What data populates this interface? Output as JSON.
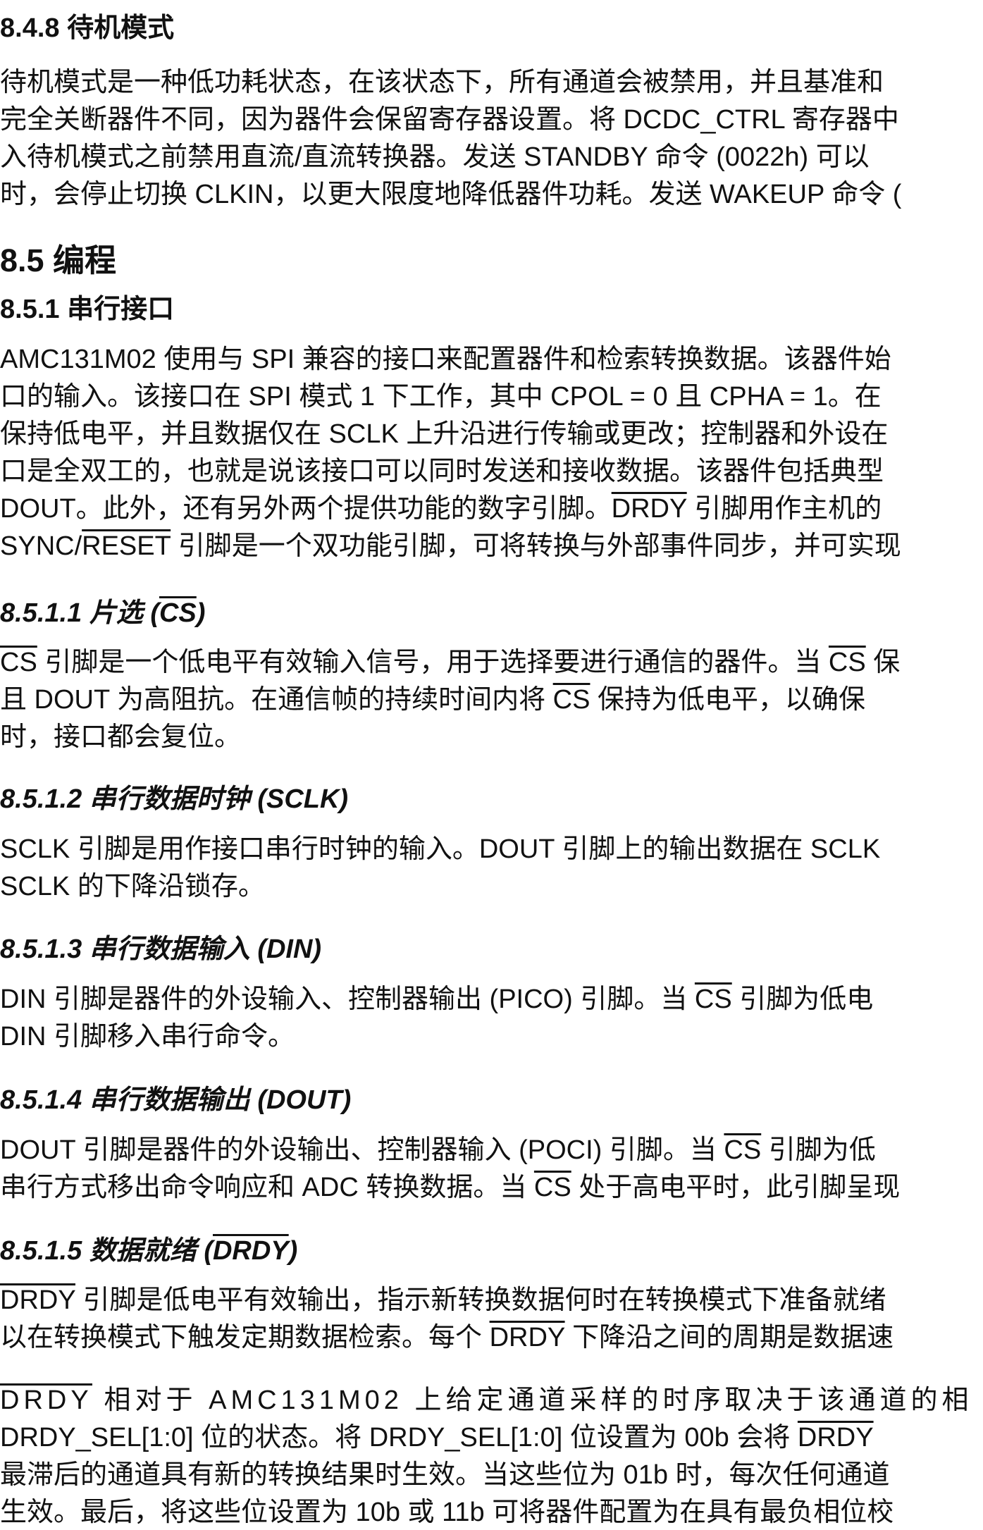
{
  "sec_848": {
    "heading": "8.4.8 待机模式",
    "lines": [
      "待机模式是一种低功耗状态，在该状态下，所有通道会被禁用，并且基准和",
      "完全关断器件不同，因为器件会保留寄存器设置。将 DCDC_CTRL 寄存器中",
      "入待机模式之前禁用直流/直流转换器。发送 STANDBY 命令 (0022h) 可以",
      "时，会停止切换 CLKIN，以更大限度地降低器件功耗。发送 WAKEUP 命令 ("
    ]
  },
  "sec_85": {
    "heading": "8.5 编程"
  },
  "sec_851": {
    "heading": "8.5.1 串行接口",
    "lines": [
      "AMC131M02 使用与 SPI 兼容的接口来配置器件和检索转换数据。该器件始",
      "口的输入。该接口在 SPI 模式 1 下工作，其中 CPOL = 0 且 CPHA = 1。在",
      "保持低电平，并且数据仅在 SCLK 上升沿进行传输或更改；控制器和外设在",
      "口是全双工的，也就是说该接口可以同时发送和接收数据。该器件包括典型"
    ],
    "line5_a": "DOUT。此外，还有另外两个提供功能的数字引脚。",
    "line5_drdy": "DRDY",
    "line5_b": " 引脚用作主机的",
    "line6_sync": "SYNC/",
    "line6_reset": "RESET",
    "line6_b": " 引脚是一个双功能引脚，可将转换与外部事件同步，并可实现"
  },
  "sec_8511": {
    "heading_a": "8.5.1.1 片选 (",
    "heading_cs": "CS",
    "heading_b": ")",
    "l1_cs1": "CS",
    "l1_a": " 引脚是一个低电平有效输入信号，用于选择要进行通信的器件。当 ",
    "l1_cs2": "CS",
    "l1_b": " 保",
    "l2_a": "且 DOUT 为高阻抗。在通信帧的持续时间内将 ",
    "l2_cs": "CS",
    "l2_b": " 保持为低电平，以确保",
    "l3": "时，接口都会复位。"
  },
  "sec_8512": {
    "heading": "8.5.1.2 串行数据时钟 (SCLK)",
    "lines": [
      "SCLK 引脚是用作接口串行时钟的输入。DOUT 引脚上的输出数据在 SCLK",
      "SCLK 的下降沿锁存。"
    ]
  },
  "sec_8513": {
    "heading": "8.5.1.3 串行数据输入 (DIN)",
    "l1_a": "DIN 引脚是器件的外设输入、控制器输出 (PICO) 引脚。当 ",
    "l1_cs": "CS",
    "l1_b": " 引脚为低电",
    "l2": "DIN 引脚移入串行命令。"
  },
  "sec_8514": {
    "heading": "8.5.1.4 串行数据输出 (DOUT)",
    "l1_a": "DOUT 引脚是器件的外设输出、控制器输入 (POCI) 引脚。当 ",
    "l1_cs": "CS",
    "l1_b": " 引脚为低",
    "l2_a": "串行方式移出命令响应和 ADC 转换数据。当 ",
    "l2_cs": "CS",
    "l2_b": " 处于高电平时，此引脚呈现"
  },
  "sec_8515": {
    "heading_a": "8.5.1.5 数据就绪 (",
    "heading_drdy": "DRDY",
    "heading_b": ")",
    "p1_l1_drdy": "DRDY",
    "p1_l1_b": " 引脚是低电平有效输出，指示新转换数据何时在转换模式下准备就绪",
    "p1_l2_a": "以在转换模式下触发定期数据检索。每个 ",
    "p1_l2_drdy": "DRDY",
    "p1_l2_b": " 下降沿之间的周期是数据速",
    "p2_l1_drdy": "DRDY",
    "p2_l1_b": " 相对于 AMC131M02 上给定通道采样的时序取决于该通道的相",
    "p2_l2_a": "DRDY_SEL[1:0] 位的状态。将 DRDY_SEL[1:0] 位设置为 00b 会将 ",
    "p2_l2_drdy": "DRDY",
    "p2_l3": "最滞后的通道具有新的转换结果时生效。当这些位为 01b 时，每次任何通道",
    "p2_l4": "生效。最后，将这些位设置为 10b 或 11b 可将器件配置为在具有最负相位校"
  }
}
